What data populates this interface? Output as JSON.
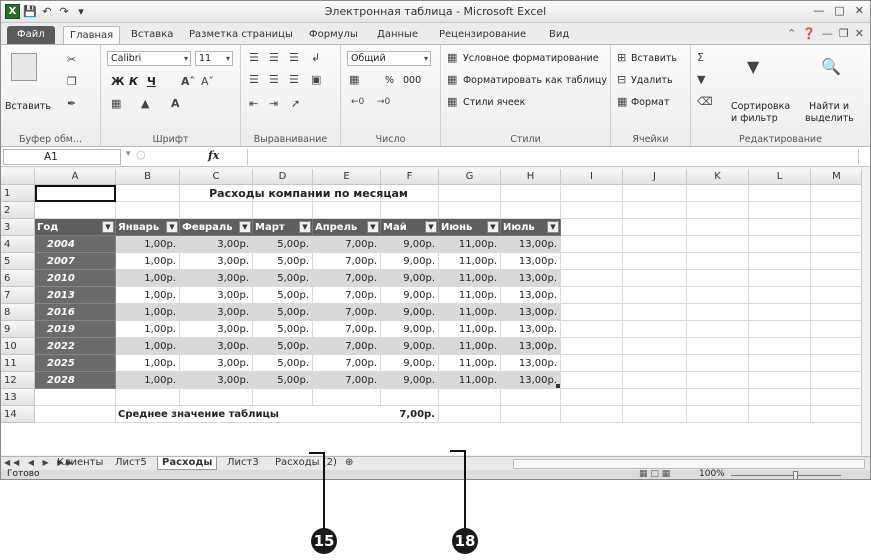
{
  "window": {
    "title": "Электронная таблица - Microsoft Excel",
    "logo": "X"
  },
  "tabs": [
    "Файл",
    "Главная",
    "Вставка",
    "Разметка страницы",
    "Формулы",
    "Данные",
    "Рецензирование",
    "Вид"
  ],
  "ribbon": {
    "clipboard": {
      "paste": "Вставить",
      "label": "Буфер обм..."
    },
    "font": {
      "name": "Calibri",
      "size": "11",
      "label": "Шрифт",
      "bold": "Ж",
      "italic": "К",
      "underline": "Ч"
    },
    "alignment": {
      "label": "Выравнивание"
    },
    "number": {
      "format": "Общий",
      "percent": "%",
      "thousands": "000",
      "label": "Число"
    },
    "styles": {
      "conditional": "Условное форматирование",
      "as_table": "Форматировать как таблицу",
      "cell_styles": "Стили ячеек",
      "label": "Стили"
    },
    "cells": {
      "insert": "Вставить",
      "delete": "Удалить",
      "format": "Формат",
      "label": "Ячейки"
    },
    "editing": {
      "sort": "Сортировка",
      "sort2": "и фильтр",
      "find": "Найти и",
      "find2": "выделить",
      "label": "Редактирование"
    }
  },
  "formula_bar": {
    "name_box": "A1",
    "fx": "fx",
    "value": ""
  },
  "columns": [
    "A",
    "B",
    "C",
    "D",
    "E",
    "F",
    "G",
    "H",
    "I",
    "J",
    "K",
    "L",
    "M"
  ],
  "rows": [
    "1",
    "2",
    "3",
    "4",
    "5",
    "6",
    "7",
    "8",
    "9",
    "10",
    "11",
    "12",
    "13",
    "14"
  ],
  "sheet": {
    "title": "Расходы компании по месяцам",
    "headers": [
      "Год",
      "Январь",
      "Февраль",
      "Март",
      "Апрель",
      "Май",
      "Июнь",
      "Июль"
    ],
    "data": [
      [
        "2004",
        "1,00р.",
        "3,00р.",
        "5,00р.",
        "7,00р.",
        "9,00р.",
        "11,00р.",
        "13,00р."
      ],
      [
        "2007",
        "1,00р.",
        "3,00р.",
        "5,00р.",
        "7,00р.",
        "9,00р.",
        "11,00р.",
        "13,00р."
      ],
      [
        "2010",
        "1,00р.",
        "3,00р.",
        "5,00р.",
        "7,00р.",
        "9,00р.",
        "11,00р.",
        "13,00р."
      ],
      [
        "2013",
        "1,00р.",
        "3,00р.",
        "5,00р.",
        "7,00р.",
        "9,00р.",
        "11,00р.",
        "13,00р."
      ],
      [
        "2016",
        "1,00р.",
        "3,00р.",
        "5,00р.",
        "7,00р.",
        "9,00р.",
        "11,00р.",
        "13,00р."
      ],
      [
        "2019",
        "1,00р.",
        "3,00р.",
        "5,00р.",
        "7,00р.",
        "9,00р.",
        "11,00р.",
        "13,00р."
      ],
      [
        "2022",
        "1,00р.",
        "3,00р.",
        "5,00р.",
        "7,00р.",
        "9,00р.",
        "11,00р.",
        "13,00р."
      ],
      [
        "2025",
        "1,00р.",
        "3,00р.",
        "5,00р.",
        "7,00р.",
        "9,00р.",
        "11,00р.",
        "13,00р."
      ],
      [
        "2028",
        "1,00р.",
        "3,00р.",
        "5,00р.",
        "7,00р.",
        "9,00р.",
        "11,00р.",
        "13,00р."
      ]
    ],
    "avg_label": "Среднее значение таблицы",
    "avg_value": "7,00р."
  },
  "sheet_tabs": [
    "Клиенты",
    "Лист5",
    "Расходы",
    "Лист3",
    "Расходы (2)"
  ],
  "active_sheet": "Расходы",
  "status": {
    "ready": "Готово",
    "zoom": "100%"
  },
  "callouts": [
    "15",
    "18"
  ]
}
